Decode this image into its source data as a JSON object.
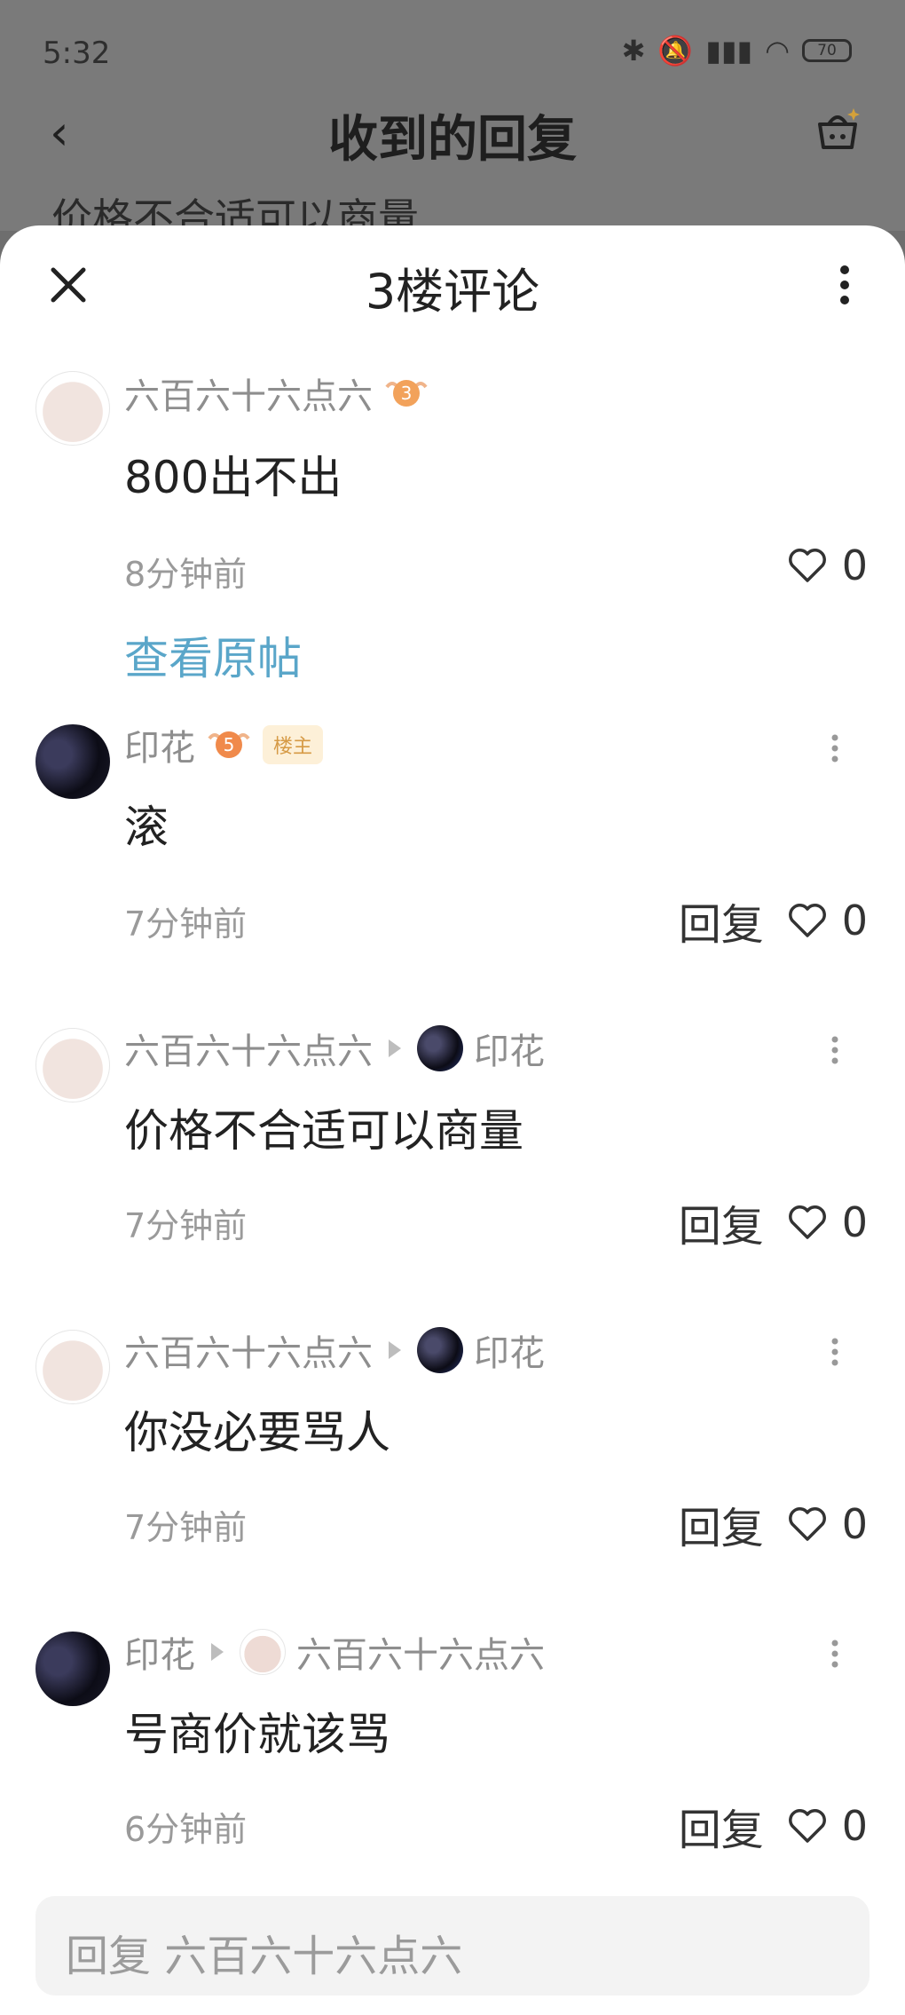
{
  "status": {
    "time": "5:32",
    "battery": "70"
  },
  "background": {
    "title": "收到的回复",
    "snippet": "价格不合适可以商量"
  },
  "sheet": {
    "title": "3楼评论",
    "main_comment": {
      "username": "六百六十六点六",
      "level": "3",
      "content": "800出不出",
      "time": "8分钟前",
      "likes": "0",
      "view_original": "查看原帖"
    },
    "replies": [
      {
        "username": "印花",
        "level": "5",
        "tag": "楼主",
        "reply_to": "",
        "content": "滚",
        "time": "7分钟前",
        "reply_label": "回复",
        "likes": "0"
      },
      {
        "username": "六百六十六点六",
        "level": "",
        "tag": "",
        "reply_to": "印花",
        "content": "价格不合适可以商量",
        "time": "7分钟前",
        "reply_label": "回复",
        "likes": "0"
      },
      {
        "username": "六百六十六点六",
        "level": "",
        "tag": "",
        "reply_to": "印花",
        "content": "你没必要骂人",
        "time": "7分钟前",
        "reply_label": "回复",
        "likes": "0"
      },
      {
        "username": "印花",
        "level": "",
        "tag": "",
        "reply_to": "六百六十六点六",
        "content": "号商价就该骂",
        "time": "6分钟前",
        "reply_label": "回复",
        "likes": "0"
      }
    ],
    "input_placeholder": "回复 六百六十六点六"
  },
  "icons": {
    "close": "close-icon",
    "more": "more-vertical-icon",
    "heart": "heart-icon",
    "back": "back-arrow-icon",
    "basket": "basket-icon"
  }
}
